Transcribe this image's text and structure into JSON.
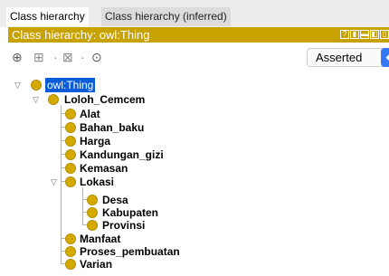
{
  "tabs": [
    "Class hierarchy",
    "Class hierarchy (inferred)"
  ],
  "title": "Class hierarchy: owl:Thing",
  "view_mode": "Asserted",
  "tree": {
    "root": "owl:Thing",
    "child": "Loloh_Cemcem",
    "items": [
      "Alat",
      "Bahan_baku",
      "Harga",
      "Kandungan_gizi",
      "Kemasan",
      "Lokasi",
      "Manfaat",
      "Proses_pembuatan",
      "Varian"
    ],
    "lokasi_children": [
      "Desa",
      "Kabupaten",
      "Provinsi"
    ]
  },
  "colors": {
    "accent": "#c8a200",
    "class_dot": "#d4aa00",
    "selection": "#0a5bd8"
  }
}
